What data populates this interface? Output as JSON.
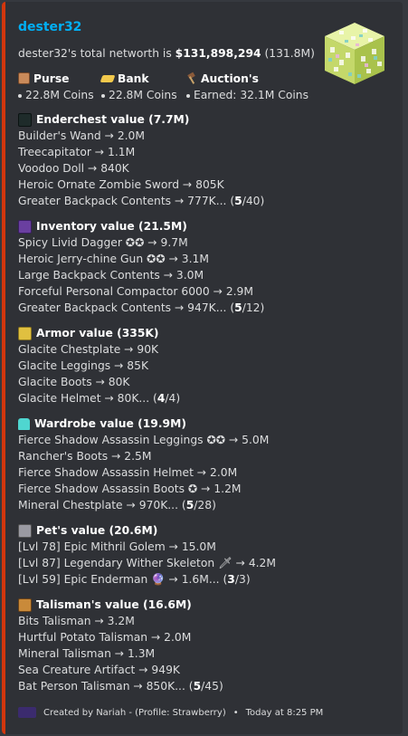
{
  "embed": {
    "accent_color": "#d2360d",
    "title": "dester32",
    "networth_prefix": "dester32's total networth is ",
    "networth_value": "$131,898,294",
    "networth_short": " (131.8M)",
    "thumbnail_icon": "skyblock-block-icon"
  },
  "fields": [
    {
      "name": "Purse",
      "icon": "purse-icon",
      "value": "22.8M Coins"
    },
    {
      "name": "Bank",
      "icon": "bank-icon",
      "value": "22.8M Coins"
    },
    {
      "name": "Auction's",
      "icon": "auction-icon",
      "value": "Earned: 32.1M Coins"
    }
  ],
  "sections": [
    {
      "title": "Enderchest value (7.7M)",
      "icon": "enderchest-icon",
      "items": [
        "Builder's Wand → 2.0M",
        "Treecapitator → 1.1M",
        "Voodoo Doll → 840K",
        "Heroic Ornate Zombie Sword → 805K"
      ],
      "last_item": "Greater Backpack Contents → 777K... (",
      "count": "5",
      "total": "/40)"
    },
    {
      "title": "Inventory value (21.5M)",
      "icon": "inventory-icon",
      "items": [
        "Spicy Livid Dagger ✪✪ → 9.7M",
        "Heroic Jerry-chine Gun ✪✪ → 3.1M",
        "Large Backpack Contents → 3.0M",
        "Forceful Personal Compactor 6000 → 2.9M"
      ],
      "last_item": "Greater Backpack Contents → 947K... (",
      "count": "5",
      "total": "/12)"
    },
    {
      "title": "Armor value (335K)",
      "icon": "armor-icon",
      "items": [
        "Glacite Chestplate → 90K",
        "Glacite Leggings → 85K",
        "Glacite Boots → 80K"
      ],
      "last_item": "Glacite Helmet → 80K... (",
      "count": "4",
      "total": "/4)"
    },
    {
      "title": "Wardrobe value (19.9M)",
      "icon": "wardrobe-icon",
      "items": [
        "Fierce Shadow Assassin Leggings ✪✪ → 5.0M",
        "Rancher's Boots → 2.5M",
        "Fierce Shadow Assassin Helmet → 2.0M",
        "Fierce Shadow Assassin Boots ✪ → 1.2M"
      ],
      "last_item": "Mineral Chestplate → 970K... (",
      "count": "5",
      "total": "/28)"
    },
    {
      "title": "Pet's value (20.6M)",
      "icon": "pet-icon",
      "items": [
        "[Lvl 78] Epic Mithril Golem → 15.0M",
        "[Lvl 87] Legendary Wither Skeleton 🗡 → 4.2M"
      ],
      "last_item": "[Lvl 59] Epic Enderman 🔮 → 1.6M... (",
      "count": "3",
      "total": "/3)"
    },
    {
      "title": "Talisman's value (16.6M)",
      "icon": "talisman-icon",
      "items": [
        "Bits Talisman → 3.2M",
        "Hurtful Potato Talisman → 2.0M",
        "Mineral Talisman → 1.3M",
        "Sea Creature Artifact → 949K"
      ],
      "last_item": "Bat Person Talisman → 850K... (",
      "count": "5",
      "total": "/45)"
    }
  ],
  "footer": {
    "text": "Created by Nariah - (Profile: Strawberry)",
    "separator": "•",
    "timestamp": "Today at 8:25 PM"
  }
}
